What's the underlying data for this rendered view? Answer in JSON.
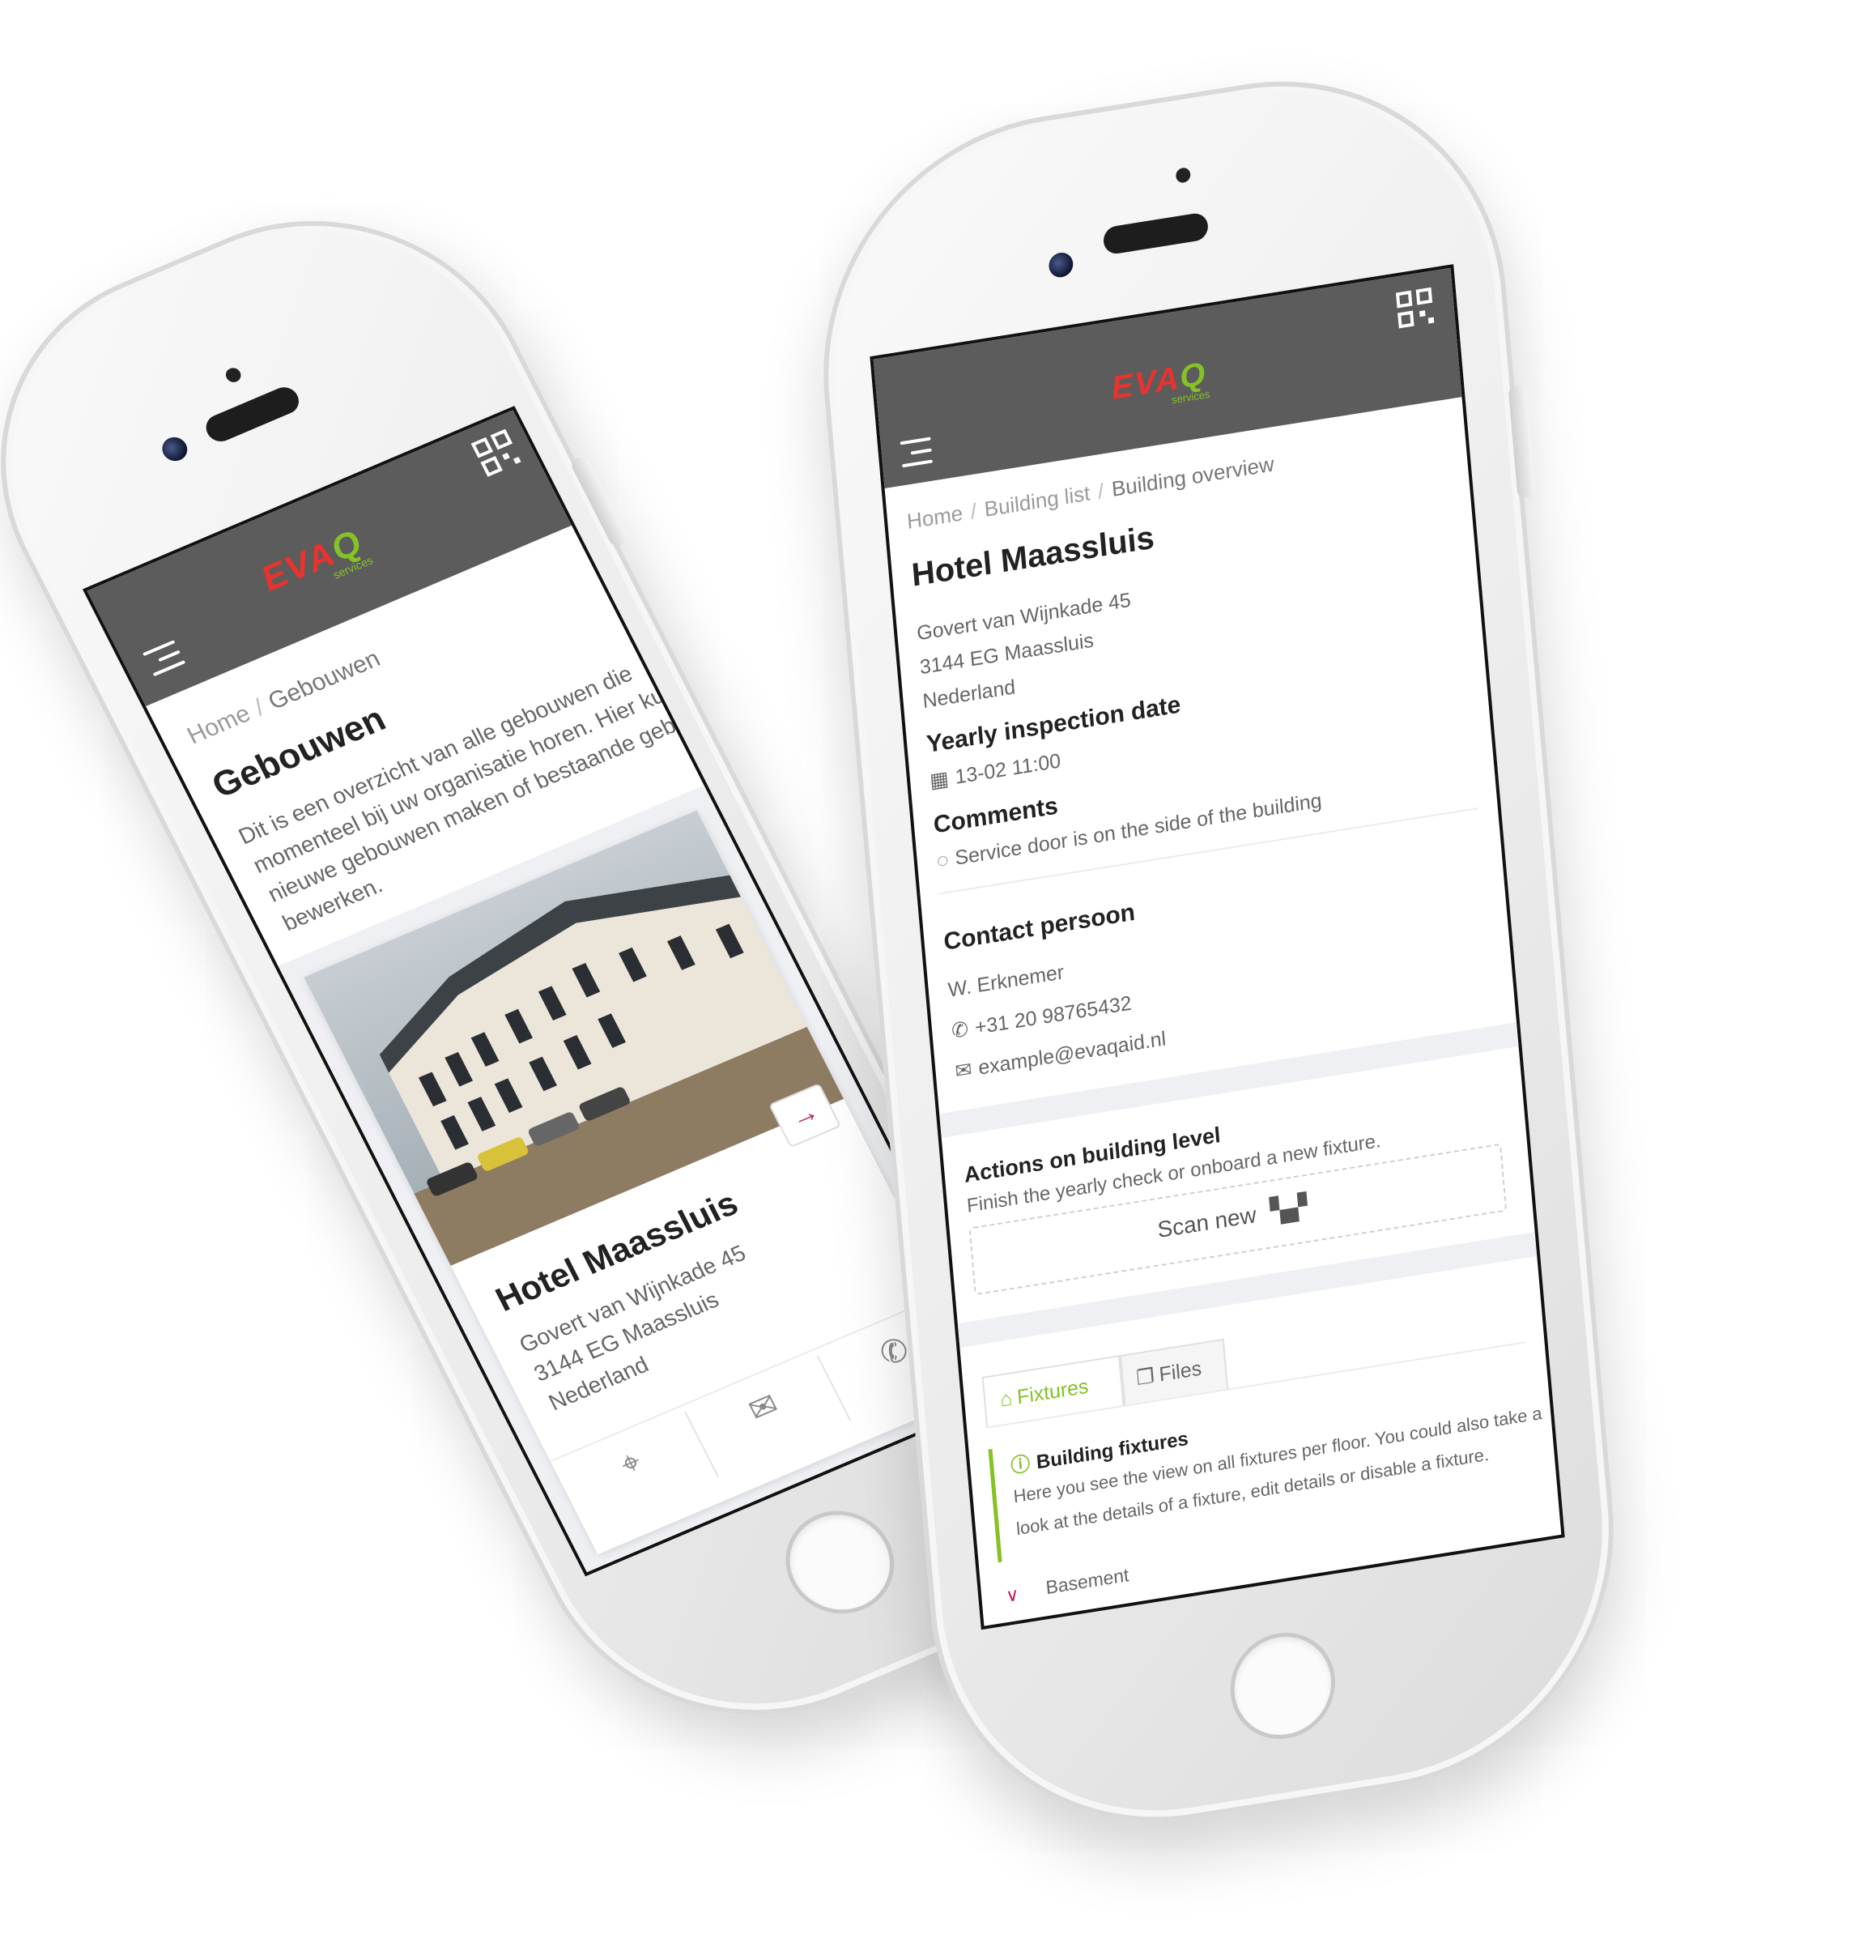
{
  "brand": {
    "logo_main": "EVA",
    "logo_q": "Q",
    "logo_sub": "services",
    "color_red": "#e8332f",
    "color_green": "#84c225",
    "header_color": "#5c5c5c",
    "accent_pink": "#c2185b"
  },
  "left_phone": {
    "breadcrumb": {
      "home": "Home",
      "sep": "/",
      "current": "Gebouwen"
    },
    "title": "Gebouwen",
    "intro": [
      "Dit is een overzicht van alle gebouwen die",
      "momenteel bij uw organisatie horen. Hier kunt u",
      "nieuwe gebouwen maken of bestaande gebouwen",
      "bewerken."
    ],
    "card": {
      "name": "Hotel Maassluis",
      "address": [
        "Govert van Wijnkade 45",
        "3144 EG Maassluis",
        "Nederland"
      ],
      "arrow_icon": "arrow-right-icon"
    },
    "footer_icons": [
      "location-pin-icon",
      "mail-icon",
      "phone-icon"
    ]
  },
  "right_phone": {
    "breadcrumb": {
      "home": "Home",
      "sep1": "/",
      "list": "Building list",
      "sep2": "/",
      "current": "Building overview"
    },
    "title": "Hotel Maassluis",
    "address": [
      "Govert van Wijnkade 45",
      "3144 EG Maassluis",
      "Nederland"
    ],
    "inspection": {
      "label": "Yearly inspection date",
      "value": "13-02 11:00",
      "icon": "calendar-icon"
    },
    "comments": {
      "label": "Comments",
      "value": "Service door is on the side of the building",
      "icon": "comment-icon"
    },
    "contact": {
      "label": "Contact persoon",
      "name": "W. Erknemer",
      "phone": "+31 20 98765432",
      "email": "example@evaqaid.nl"
    },
    "actions": {
      "title": "Actions on building level",
      "subtitle": "Finish the yearly check or onboard a new fixture.",
      "scan_label": "Scan new"
    },
    "tabs": [
      {
        "label": "Fixtures",
        "icon": "home-icon",
        "active": true
      },
      {
        "label": "Files",
        "icon": "files-icon",
        "active": false
      }
    ],
    "info": {
      "title": "Building fixtures",
      "text": [
        "Here you see the view on all fixtures per floor. You could also take a",
        "look at the details of a fixture, edit details or disable a fixture."
      ]
    },
    "floors": [
      {
        "label": "Basement",
        "icon": "chevron-down-icon"
      }
    ]
  }
}
